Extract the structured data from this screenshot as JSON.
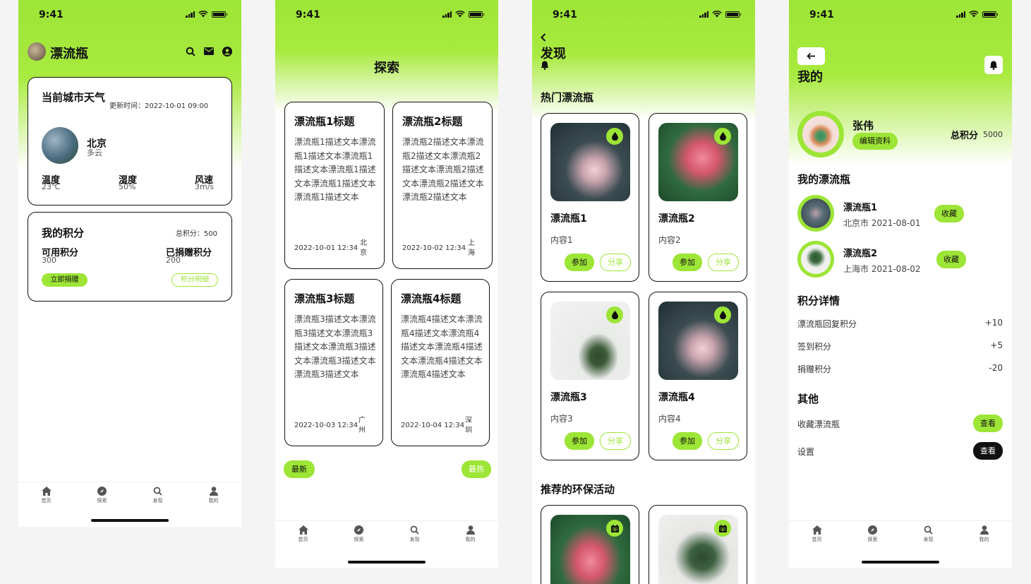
{
  "status": {
    "time": "9:41"
  },
  "tabbar": [
    "首页",
    "探索",
    "发现",
    "我的"
  ],
  "colors": {
    "accent": "#9de536",
    "text": "#111111"
  },
  "screen1": {
    "app_title": "漂流瓶",
    "weather": {
      "title": "当前城市天气",
      "update_time": "更新时间：2022-10-01 09:00",
      "city": "北京",
      "condition": "多云",
      "temp_label": "温度",
      "temp_value": "23℃",
      "humidity_label": "湿度",
      "humidity_value": "50%",
      "wind_label": "风速",
      "wind_value": "3m/s"
    },
    "points": {
      "title": "我的积分",
      "total": "总积分：500",
      "available_label": "可用积分",
      "available_value": "300",
      "donated_label": "已捐赠积分",
      "donated_value": "200",
      "donate_button": "立即捐赠",
      "detail_button": "积分明细"
    }
  },
  "screen2": {
    "title": "探索",
    "bottles": [
      {
        "title": "漂流瓶1标题",
        "desc": "漂流瓶1描述文本漂流瓶1描述文本漂流瓶1描述文本漂流瓶1描述文本漂流瓶1描述文本漂流瓶1描述文本",
        "date": "2022-10-01 12:34",
        "city": "北京"
      },
      {
        "title": "漂流瓶2标题",
        "desc": "漂流瓶2描述文本漂流瓶2描述文本漂流瓶2描述文本漂流瓶2描述文本漂流瓶2描述文本漂流瓶2描述文本",
        "date": "2022-10-02 12:34",
        "city": "上海"
      },
      {
        "title": "漂流瓶3标题",
        "desc": "漂流瓶3描述文本漂流瓶3描述文本漂流瓶3描述文本漂流瓶3描述文本漂流瓶3描述文本漂流瓶3描述文本",
        "date": "2022-10-03 12:34",
        "city": "广州"
      },
      {
        "title": "漂流瓶4标题",
        "desc": "漂流瓶4描述文本漂流瓶4描述文本漂流瓶4描述文本漂流瓶4描述文本漂流瓶4描述文本漂流瓶4描述文本",
        "date": "2022-10-04 12:34",
        "city": "深圳"
      }
    ],
    "sort_latest": "最新",
    "sort_hot": "最热"
  },
  "screen3": {
    "title": "发现",
    "hot_title": "热门漂流瓶",
    "cards": [
      {
        "title": "漂流瓶1",
        "content": "内容1",
        "join": "参加",
        "share": "分享"
      },
      {
        "title": "漂流瓶2",
        "content": "内容2",
        "join": "参加",
        "share": "分享"
      },
      {
        "title": "漂流瓶3",
        "content": "内容3",
        "join": "参加",
        "share": "分享"
      },
      {
        "title": "漂流瓶4",
        "content": "内容4",
        "join": "参加",
        "share": "分享"
      }
    ],
    "activities_title": "推荐的环保活动"
  },
  "screen4": {
    "title": "我的",
    "user": {
      "name": "张伟",
      "edit": "编辑资料",
      "points_label": "总积分",
      "points_value": "5000"
    },
    "my_bottles_title": "我的漂流瓶",
    "my_bottles": [
      {
        "name": "漂流瓶1",
        "meta": "北京市 2021-08-01",
        "action": "收藏"
      },
      {
        "name": "漂流瓶2",
        "meta": "上海市 2021-08-02",
        "action": "收藏"
      }
    ],
    "points_title": "积分详情",
    "points_rows": [
      {
        "label": "漂流瓶回复积分",
        "value": "+10"
      },
      {
        "label": "签到积分",
        "value": "+5"
      },
      {
        "label": "捐赠积分",
        "value": "-20"
      }
    ],
    "other_title": "其他",
    "other_rows": [
      {
        "label": "收藏漂流瓶",
        "action": "查看"
      },
      {
        "label": "设置",
        "action": "查看"
      }
    ]
  }
}
